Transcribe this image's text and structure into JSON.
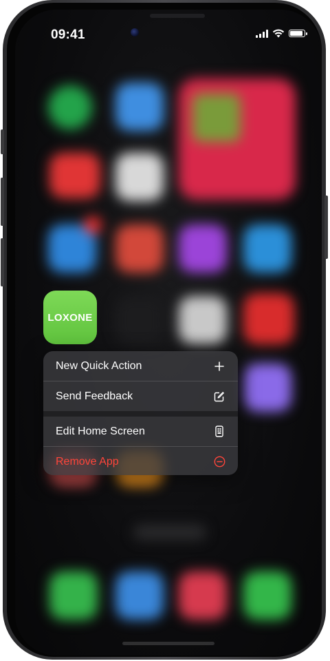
{
  "status_bar": {
    "time": "09:41",
    "icons": [
      "cellular-signal-icon",
      "wifi-icon",
      "battery-icon"
    ]
  },
  "focused_app": {
    "name": "LOXONE",
    "color": "#6cd04a"
  },
  "context_menu": {
    "items": [
      {
        "label": "New Quick Action",
        "icon": "plus-icon"
      },
      {
        "label": "Send Feedback",
        "icon": "compose-icon"
      },
      {
        "label": "Edit Home Screen",
        "icon": "phone-screen-icon"
      },
      {
        "label": "Remove App",
        "icon": "minus-circle-icon",
        "destructive": true
      }
    ],
    "destructive_color": "#ff453a"
  }
}
